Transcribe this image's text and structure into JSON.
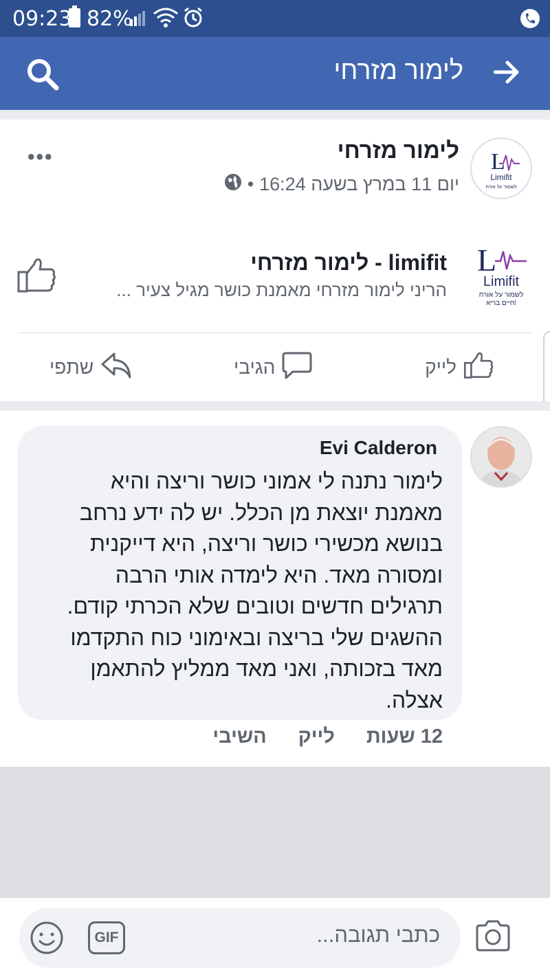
{
  "status_bar": {
    "time": "09:23",
    "battery": "82%",
    "icons": [
      "battery-icon",
      "signal-icon",
      "wifi-icon",
      "alarm-icon",
      "call-icon"
    ]
  },
  "header": {
    "title": "לימור מזרחי",
    "icons": [
      "search-icon",
      "back-arrow-icon"
    ],
    "background": "#4267b2"
  },
  "post": {
    "author": "לימור מזרחי",
    "timestamp": "יום 11 במרץ בשעה 16:24",
    "separator": "•",
    "shared_page": {
      "logo_text": "Limifit",
      "logo_tagline": "לשמור על אורח חיים בריא!",
      "title": "limifit - לימור מזרחי",
      "subtitle": "הריני לימור מזרחי מאמנת כושר  מגיל צעיר ..."
    },
    "actions": {
      "like": "לייק",
      "comment": "הגיבי",
      "share": "שתפי"
    }
  },
  "comment": {
    "author": "Evi Calderon",
    "text": "לימור נתנה לי אמוני כושר וריצה והיא מאמנת יוצאת מן הכלל. יש לה ידע נרחב בנושא מכשירי כושר וריצה, היא דייקנית ומסורה מאד. היא לימדה אותי הרבה תרגילים חדשים וטובים שלא הכרתי קודם. ההשגים שלי בריצה ובאימוני כוח התקדמו מאד בזכותה, ואני מאד ממליץ להתאמן אצלה.",
    "time": "12 שעות",
    "like": "לייק",
    "reply": "השיבי"
  },
  "composer": {
    "placeholder": "כתבי תגובה...",
    "gif": "GIF",
    "icons": [
      "emoji-icon",
      "gif-icon",
      "camera-icon"
    ]
  },
  "colors": {
    "status_bar": "#2d4f8f",
    "header": "#4267b2",
    "secondary_text": "#606770",
    "bubble": "#f0f2f5",
    "logo_purple": "#8a3fa8",
    "logo_navy": "#1f2a5e"
  }
}
